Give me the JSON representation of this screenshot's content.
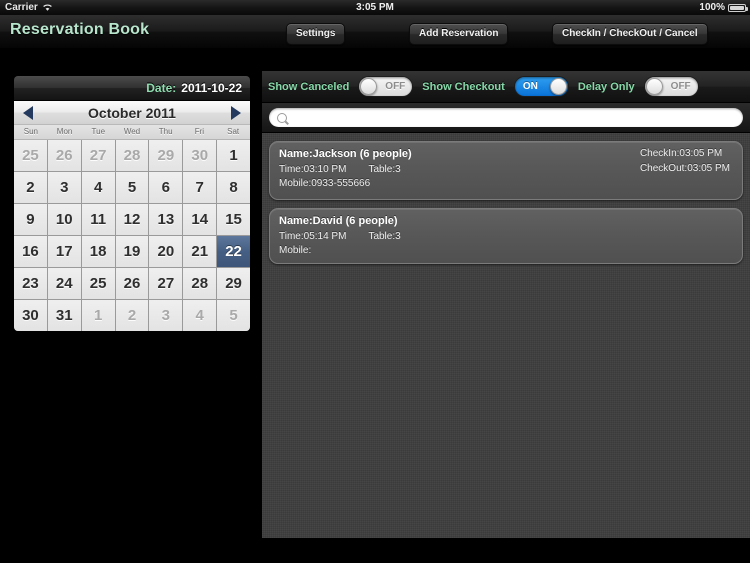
{
  "statusbar": {
    "carrier": "Carrier",
    "wifi_icon": "wifi-icon",
    "time": "3:05 PM",
    "battery_percent": "100%",
    "battery_icon": "battery-full-icon"
  },
  "toolbar": {
    "app_title": "Reservation Book",
    "settings_label": "Settings",
    "add_reservation_label": "Add Reservation",
    "checkin_checkout_cancel_label": "CheckIn / CheckOut / Cancel"
  },
  "calendar": {
    "date_label": "Date:",
    "date_value": "2011-10-22",
    "prev_icon": "chevron-left-icon",
    "next_icon": "chevron-right-icon",
    "month_title": "October 2011",
    "weekdays": [
      "Sun",
      "Mon",
      "Tue",
      "Wed",
      "Thu",
      "Fri",
      "Sat"
    ],
    "selected_day": 22,
    "weeks": [
      [
        {
          "d": "25",
          "adj": true
        },
        {
          "d": "26",
          "adj": true
        },
        {
          "d": "27",
          "adj": true
        },
        {
          "d": "28",
          "adj": true
        },
        {
          "d": "29",
          "adj": true
        },
        {
          "d": "30",
          "adj": true
        },
        {
          "d": "1",
          "adj": false
        }
      ],
      [
        {
          "d": "2",
          "adj": false
        },
        {
          "d": "3",
          "adj": false
        },
        {
          "d": "4",
          "adj": false
        },
        {
          "d": "5",
          "adj": false
        },
        {
          "d": "6",
          "adj": false
        },
        {
          "d": "7",
          "adj": false
        },
        {
          "d": "8",
          "adj": false
        }
      ],
      [
        {
          "d": "9",
          "adj": false
        },
        {
          "d": "10",
          "adj": false
        },
        {
          "d": "11",
          "adj": false
        },
        {
          "d": "12",
          "adj": false
        },
        {
          "d": "13",
          "adj": false
        },
        {
          "d": "14",
          "adj": false
        },
        {
          "d": "15",
          "adj": false
        }
      ],
      [
        {
          "d": "16",
          "adj": false
        },
        {
          "d": "17",
          "adj": false
        },
        {
          "d": "18",
          "adj": false
        },
        {
          "d": "19",
          "adj": false
        },
        {
          "d": "20",
          "adj": false
        },
        {
          "d": "21",
          "adj": false
        },
        {
          "d": "22",
          "adj": false,
          "selected": true
        }
      ],
      [
        {
          "d": "23",
          "adj": false
        },
        {
          "d": "24",
          "adj": false
        },
        {
          "d": "25",
          "adj": false
        },
        {
          "d": "26",
          "adj": false
        },
        {
          "d": "27",
          "adj": false
        },
        {
          "d": "28",
          "adj": false
        },
        {
          "d": "29",
          "adj": false
        }
      ],
      [
        {
          "d": "30",
          "adj": false
        },
        {
          "d": "31",
          "adj": false
        },
        {
          "d": "1",
          "adj": true
        },
        {
          "d": "2",
          "adj": true
        },
        {
          "d": "3",
          "adj": true
        },
        {
          "d": "4",
          "adj": true
        },
        {
          "d": "5",
          "adj": true
        }
      ]
    ]
  },
  "filters": [
    {
      "label": "Show Canceled",
      "state": "OFF",
      "on": false
    },
    {
      "label": "Show Checkout",
      "state": "ON",
      "on": true
    },
    {
      "label": "Delay Only",
      "state": "OFF",
      "on": false
    }
  ],
  "search": {
    "icon": "search-icon",
    "value": "",
    "placeholder": ""
  },
  "reservations": [
    {
      "title": "Name:Jackson (6 people)",
      "time": "Time:03:10 PM",
      "table": "Table:3",
      "mobile": "Mobile:0933-555666",
      "checkin": "CheckIn:03:05 PM",
      "checkout": "CheckOut:03:05 PM"
    },
    {
      "title": "Name:David (6 people)",
      "time": "Time:05:14 PM",
      "table": "Table:3",
      "mobile": "Mobile:",
      "checkin": "",
      "checkout": ""
    }
  ],
  "colors": {
    "accent_green": "#86d8a8",
    "switch_on_blue": "#0a72d8",
    "selected_day_blue": "#455f84"
  }
}
